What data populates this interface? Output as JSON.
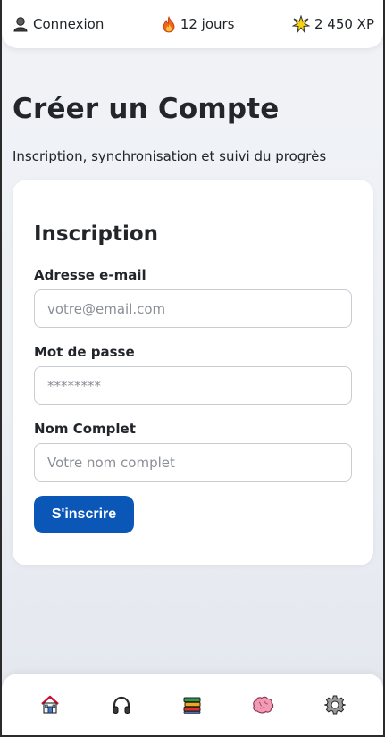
{
  "topbar": {
    "login": {
      "label": "Connexion",
      "icon": "user-silhouette-icon"
    },
    "streak": {
      "label": "12 jours",
      "icon": "fire-icon"
    },
    "xp": {
      "label": "2 450 XP",
      "icon": "sparkle-icon"
    }
  },
  "page": {
    "title": "Créer un Compte",
    "subtitle": "Inscription, synchronisation et suivi du progrès"
  },
  "form": {
    "title": "Inscription",
    "email_label": "Adresse e-mail",
    "email_placeholder": "votre@email.com",
    "email_value": "",
    "password_label": "Mot de passe",
    "password_placeholder": "********",
    "password_value": "",
    "name_label": "Nom Complet",
    "name_placeholder": "Votre nom complet",
    "name_value": "",
    "submit_label": "S'inscrire"
  },
  "colors": {
    "primary": "#0b57b8",
    "text": "#22262b",
    "background": "#eceff4",
    "card": "#ffffff"
  },
  "bottom_nav": [
    {
      "icon": "home-icon"
    },
    {
      "icon": "headphones-icon"
    },
    {
      "icon": "books-icon"
    },
    {
      "icon": "brain-icon"
    },
    {
      "icon": "gear-icon"
    }
  ]
}
